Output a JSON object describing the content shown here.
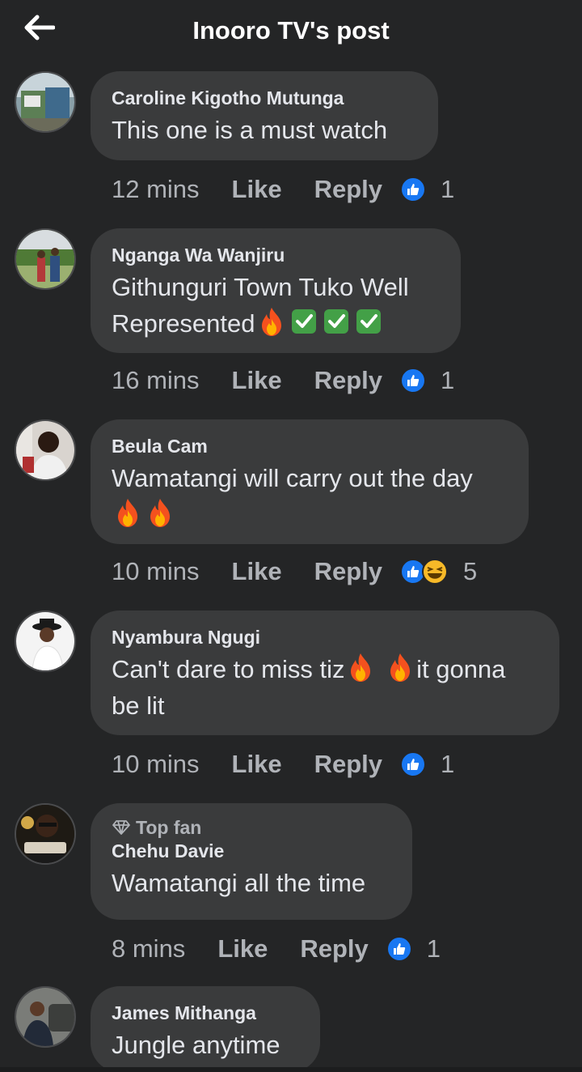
{
  "header": {
    "title": "Inooro TV's post"
  },
  "comments": [
    {
      "author": "Caroline Kigotho Mutunga",
      "text": "This one is a must watch",
      "time": "12 mins",
      "like": "Like",
      "reply": "Reply",
      "reaction_count": "1"
    },
    {
      "author": "Nganga Wa Wanjiru",
      "text_line1": "Githunguri Town Tuko Well",
      "text_line2": "Represented",
      "time": "16 mins",
      "like": "Like",
      "reply": "Reply",
      "reaction_count": "1"
    },
    {
      "author": "Beula Cam",
      "text": "Wamatangi will carry out the day",
      "time": "10 mins",
      "like": "Like",
      "reply": "Reply",
      "reaction_count": "5"
    },
    {
      "author": "Nyambura Ngugi",
      "text_part1": "Can't dare to miss tiz",
      "text_part2": "it gonna",
      "text_line2": "be lit",
      "time": "10 mins",
      "like": "Like",
      "reply": "Reply",
      "reaction_count": "1"
    },
    {
      "badge": "Top fan",
      "author": "Chehu Davie",
      "text": "Wamatangi all the time",
      "time": "8 mins",
      "like": "Like",
      "reply": "Reply",
      "reaction_count": "1"
    },
    {
      "author": "James Mithanga",
      "text": "Jungle anytime"
    }
  ],
  "avatars": {
    "caroline": "Caroline avatar (storefront photo)",
    "nganga": "Nganga avatar (two men outdoors)",
    "beula": "Beula avatar (woman portrait)",
    "nyambura": "Nyambura avatar (woman with hat)",
    "chehu": "Chehu avatar (man with logo)",
    "james": "James avatar (man near car)"
  },
  "colors": {
    "background": "#242526",
    "bubble": "#3a3b3c",
    "like_blue": "#1877f2",
    "muted": "#b0b3b8"
  }
}
